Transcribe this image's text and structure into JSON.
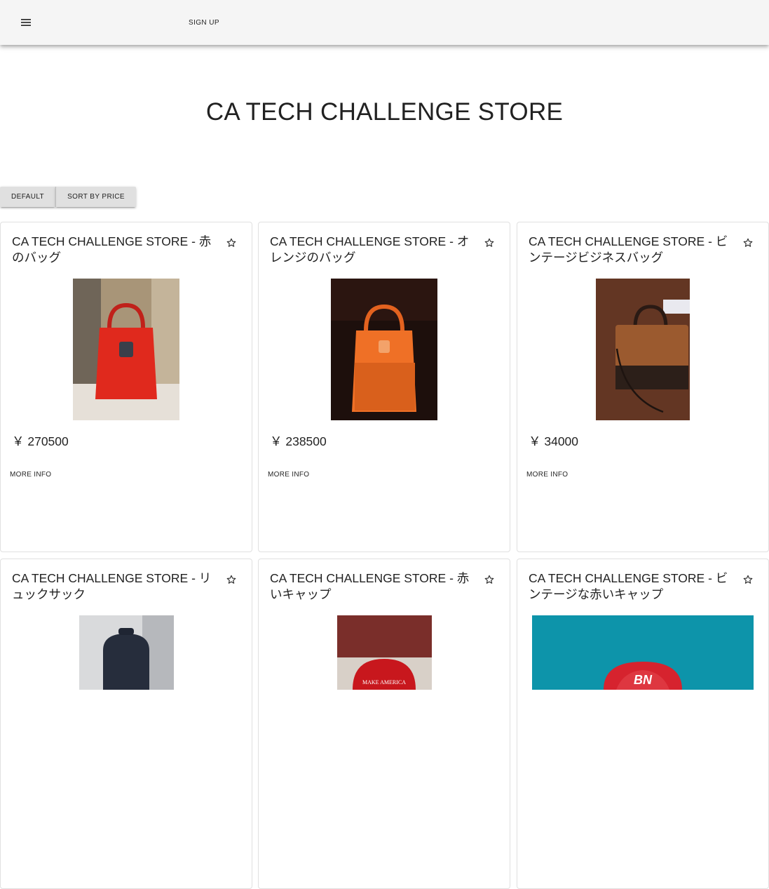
{
  "header": {
    "menu_icon": "menu-icon",
    "signup_label": "SIGN UP"
  },
  "hero": {
    "title": "CA TECH CHALLENGE STORE"
  },
  "sort": {
    "default_label": "DEFAULT",
    "price_label": "SORT BY PRICE"
  },
  "products": [
    {
      "title": "CA TECH CHALLENGE STORE - 赤のバッグ",
      "price": "￥ 270500",
      "more_label": "MORE INFO",
      "favorite_icon": "star-outline-icon",
      "image": "red-bag"
    },
    {
      "title": "CA TECH CHALLENGE STORE - オレンジのバッグ",
      "price": "￥ 238500",
      "more_label": "MORE INFO",
      "favorite_icon": "star-outline-icon",
      "image": "orange-bag"
    },
    {
      "title": "CA TECH CHALLENGE STORE - ビンテージビジネスバッグ",
      "price": "￥ 34000",
      "more_label": "MORE INFO",
      "favorite_icon": "star-outline-icon",
      "image": "vintage-business-bag"
    },
    {
      "title": "CA TECH CHALLENGE STORE - リュックサック",
      "favorite_icon": "star-outline-icon",
      "image": "backpack"
    },
    {
      "title": "CA TECH CHALLENGE STORE - 赤いキャップ",
      "favorite_icon": "star-outline-icon",
      "image": "red-cap",
      "image_text": "MAKE AMERICA"
    },
    {
      "title": "CA TECH CHALLENGE STORE - ビンテージな赤いキャップ",
      "favorite_icon": "star-outline-icon",
      "image": "vintage-red-cap",
      "image_text": "BN"
    }
  ]
}
